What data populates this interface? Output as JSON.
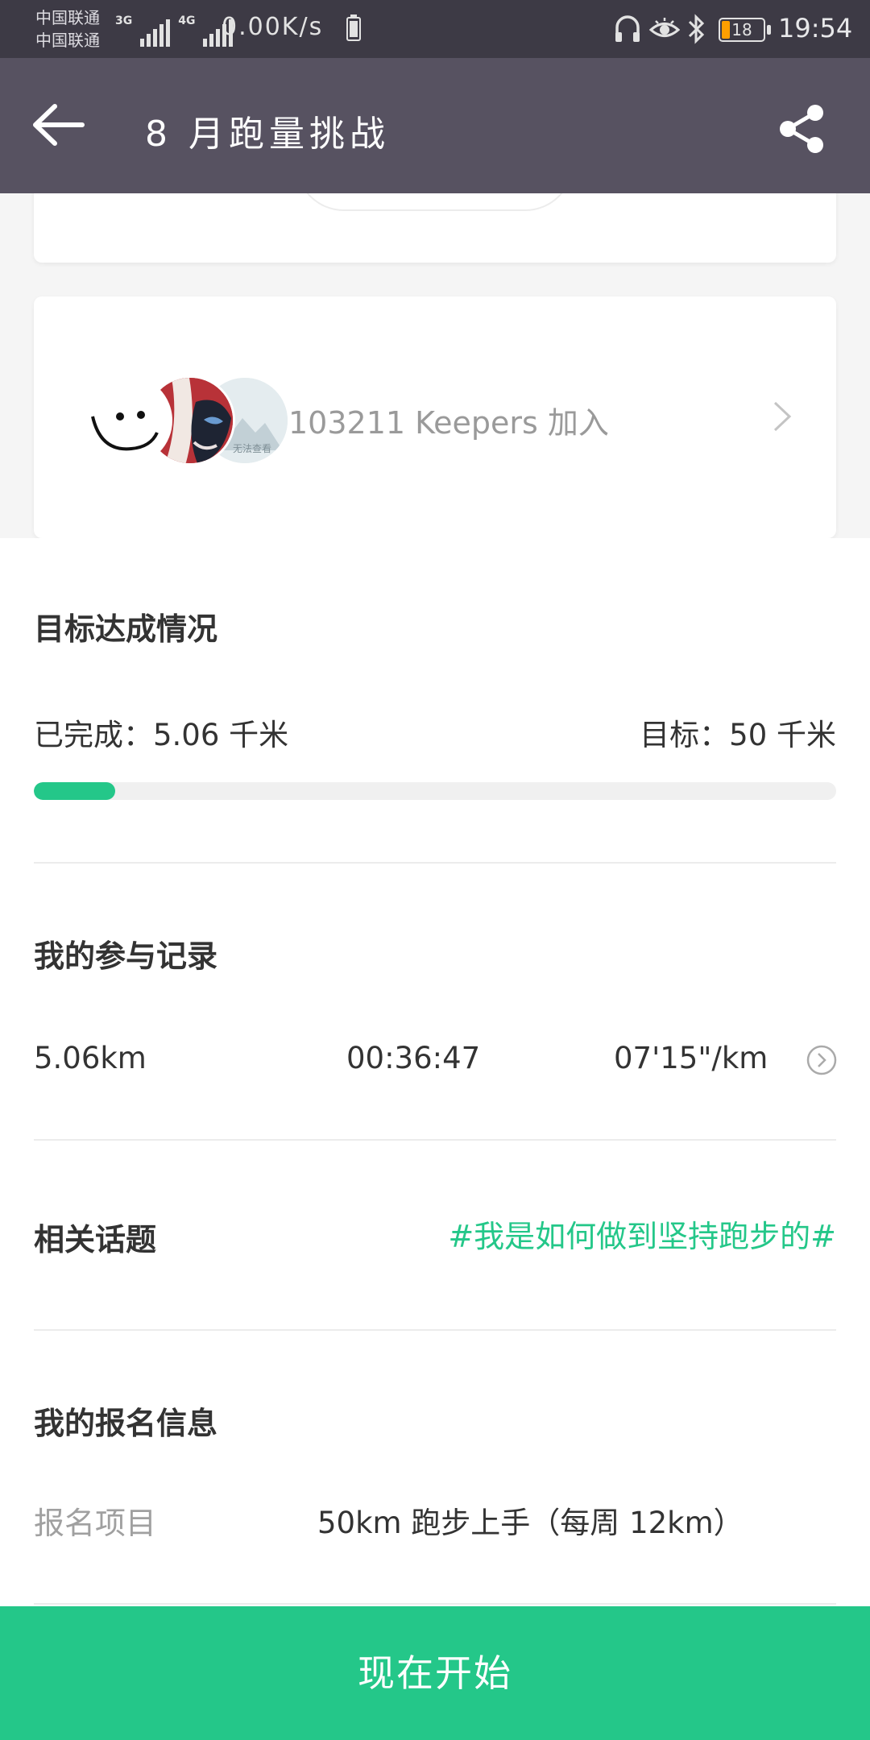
{
  "status_bar": {
    "carrier_1": "中国联通",
    "carrier_2": "中国联通",
    "network_1": "3G",
    "network_2": "4G",
    "net_speed": "0.00K/s",
    "battery_level": "18",
    "time": "19:54"
  },
  "header": {
    "title": "8 月跑量挑战"
  },
  "members": {
    "avatar_watermark": "无法查看",
    "text": "103211 Keepers 加入"
  },
  "goal": {
    "title": "目标达成情况",
    "completed": "已完成：5.06 千米",
    "target": "目标：50 千米",
    "progress_fraction": 0.1012
  },
  "records": {
    "title": "我的参与记录",
    "distance": "5.06km",
    "duration": "00:36:47",
    "pace": "07'15\"/km"
  },
  "topics": {
    "title": "相关话题",
    "link": "#我是如何做到坚持跑步的#"
  },
  "registration": {
    "title": "我的报名信息",
    "label": "报名项目",
    "value": "50km 跑步上手（每周 12km）"
  },
  "actions": {
    "start_label": "现在开始"
  },
  "colors": {
    "accent": "#24c789",
    "header_bg": "#575261",
    "status_bg": "#3d3a45"
  }
}
